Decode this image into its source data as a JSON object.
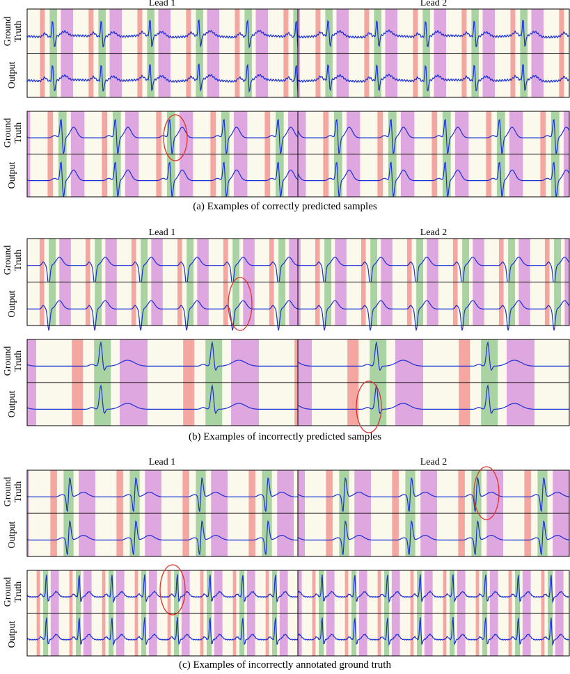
{
  "lead1": "Lead 1",
  "lead2": "Lead 2",
  "row_top": "Ground",
  "row_top_2": "Truth",
  "row_bottom": "Output",
  "captions": {
    "a": "(a) Examples of correctly predicted samples",
    "b": "(b) Examples of incorrectly predicted samples",
    "c": "(c) Examples of incorrectly annotated ground truth"
  },
  "colors": {
    "p_wave": "#f4a6a0",
    "qrs": "#a9d3a3",
    "t_wave": "#dfa7e0",
    "background": "#fbf8ec",
    "signal": "#1a2fd6",
    "error_circle": "#e0302a"
  }
}
